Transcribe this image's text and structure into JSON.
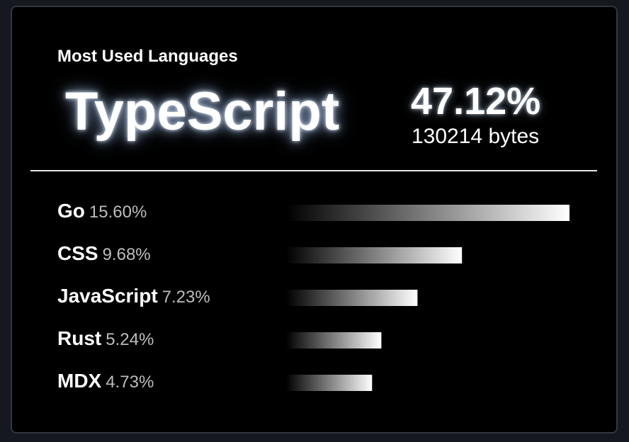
{
  "header": {
    "title": "Most Used Languages"
  },
  "top_language": {
    "name": "TypeScript",
    "percent": "47.12%",
    "bytes": "130214 bytes"
  },
  "languages": [
    {
      "name": "Go",
      "percent": "15.60%"
    },
    {
      "name": "CSS",
      "percent": "9.68%"
    },
    {
      "name": "JavaScript",
      "percent": "7.23%"
    },
    {
      "name": "Rust",
      "percent": "5.24%"
    },
    {
      "name": "MDX",
      "percent": "4.73%"
    }
  ],
  "colors": {
    "background": "#000000",
    "text": "#ffffff",
    "muted": "#bdbdbd",
    "bar_start": "#000000",
    "bar_end": "#ffffff"
  },
  "chart_data": {
    "type": "bar",
    "orientation": "horizontal",
    "title": "Most Used Languages",
    "categories": [
      "Go",
      "CSS",
      "JavaScript",
      "Rust",
      "MDX"
    ],
    "values": [
      15.6,
      9.68,
      7.23,
      5.24,
      4.73
    ],
    "unit": "%",
    "xlim": [
      0,
      15.6
    ],
    "grid": false
  }
}
